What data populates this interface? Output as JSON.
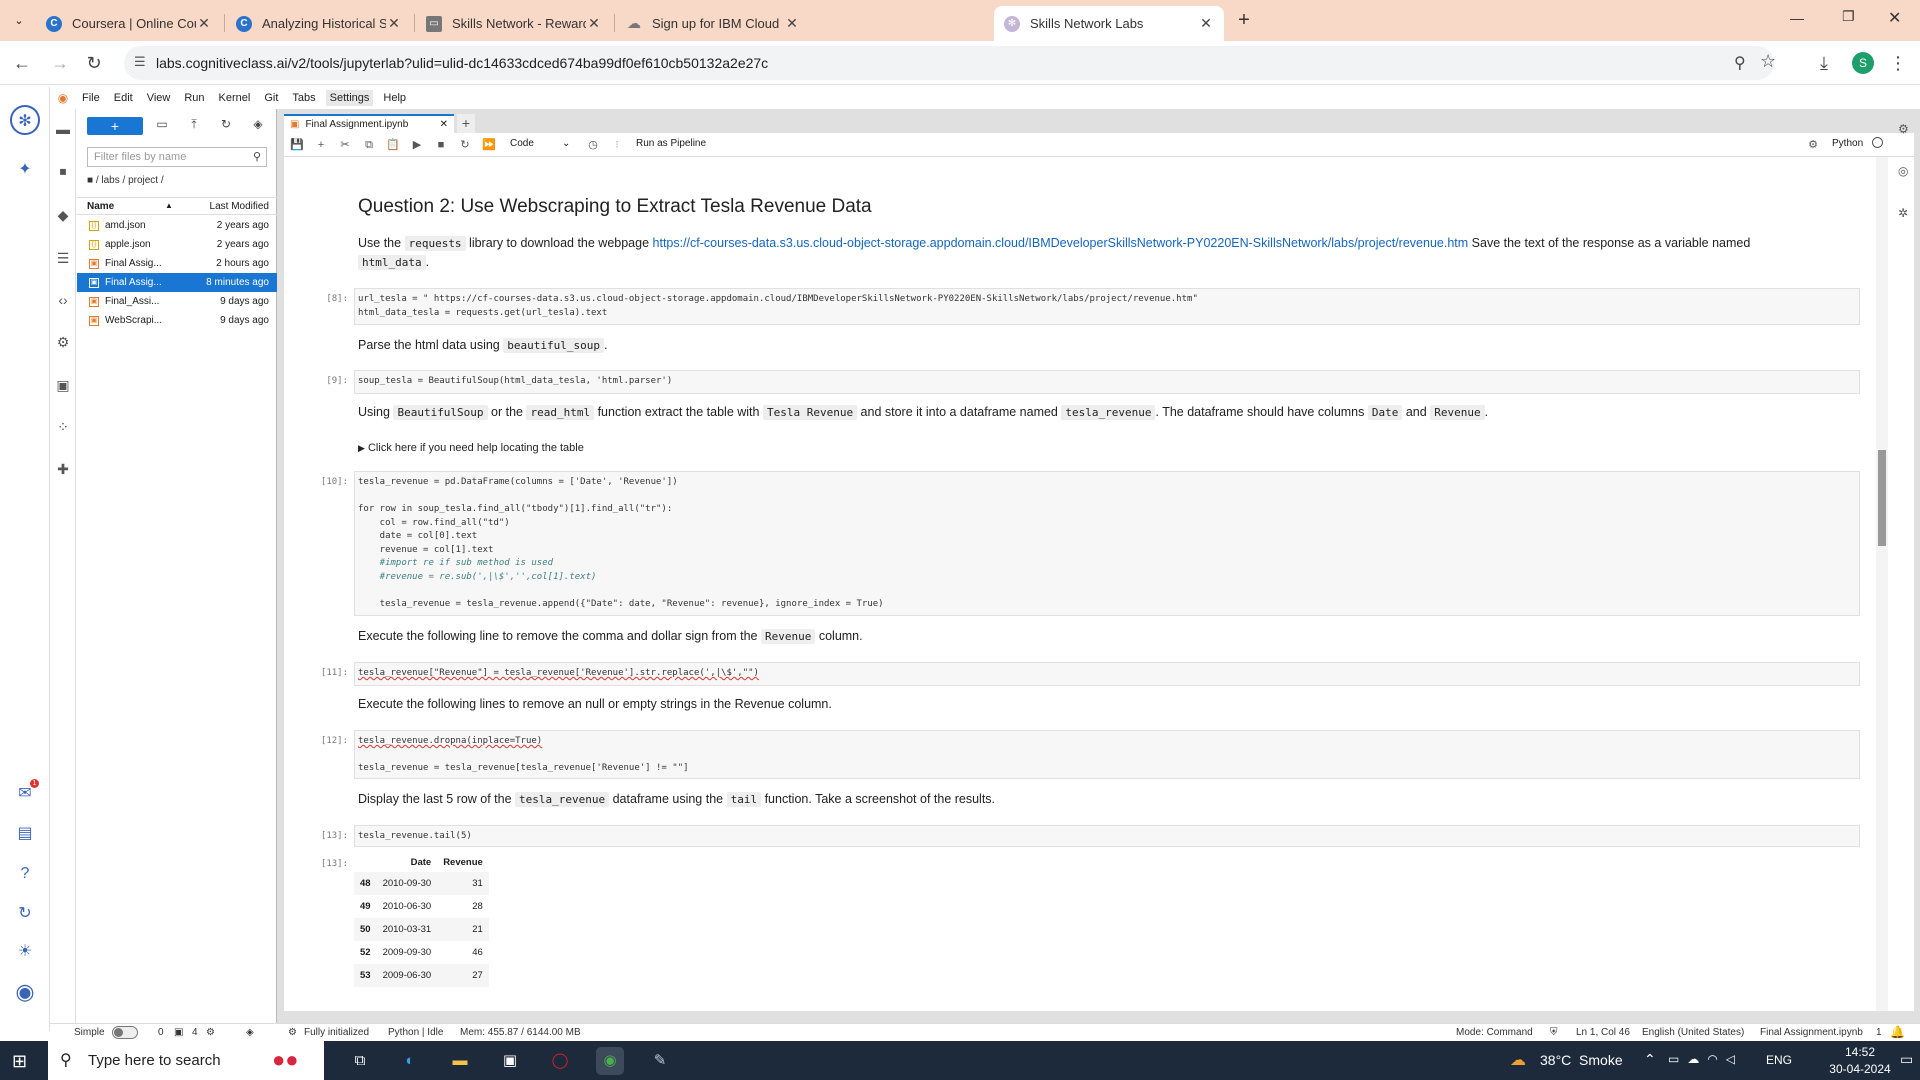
{
  "browser": {
    "tabs": [
      {
        "title": "Coursera | Online Courses Fro",
        "icon": "coursera-icon"
      },
      {
        "title": "Analyzing Historical Stock/Rev",
        "icon": "coursera-icon"
      },
      {
        "title": "Skills Network - Reward",
        "icon": "ticket-icon"
      },
      {
        "title": "Sign up for IBM Cloud",
        "icon": "cloud-icon"
      },
      {
        "title": "Skills Network Labs",
        "icon": "skills-network-icon"
      }
    ],
    "url": "labs.cognitiveclass.ai/v2/tools/jupyterlab?ulid=ulid-dc14633cdced674ba99df0ef610cb50132a2e27c",
    "profile_initial": "S"
  },
  "jupyter": {
    "menu": [
      "File",
      "Edit",
      "View",
      "Run",
      "Kernel",
      "Git",
      "Tabs",
      "Settings",
      "Help"
    ],
    "filebrowser": {
      "filter_placeholder": "Filter files by name",
      "breadcrumb": "/ labs / project /",
      "col_name": "Name",
      "col_modified": "Last Modified",
      "files": [
        {
          "name": "amd.json",
          "modified": "2 years ago"
        },
        {
          "name": "apple.json",
          "modified": "2 years ago"
        },
        {
          "name": "Final Assig...",
          "modified": "2 hours ago"
        },
        {
          "name": "Final Assig...",
          "modified": "8 minutes ago"
        },
        {
          "name": "Final_Assi...",
          "modified": "9 days ago"
        },
        {
          "name": "WebScrapi...",
          "modified": "9 days ago"
        }
      ]
    },
    "doc_tab": "Final Assignment.ipynb",
    "toolbar": {
      "cell_type": "Code",
      "pipeline": "Run as Pipeline",
      "kernel": "Python"
    },
    "notebook": {
      "heading": "Question 2: Use Webscraping to Extract Tesla Revenue Data",
      "md1_a": "Use the",
      "md1_code1": "requests",
      "md1_b": "library to download the webpage",
      "md1_link": "https://cf-courses-data.s3.us.cloud-object-storage.appdomain.cloud/IBMDeveloperSkillsNetwork-PY0220EN-SkillsNetwork/labs/project/revenue.htm",
      "md1_c": "Save the text of the response as a variable named",
      "md1_code2": "html_data",
      "p8": "[8]:",
      "c8_l1": "url_tesla = \" https://cf-courses-data.s3.us.cloud-object-storage.appdomain.cloud/IBMDeveloperSkillsNetwork-PY0220EN-SkillsNetwork/labs/project/revenue.htm\"",
      "c8_l2": "html_data_tesla = requests.get(url_tesla).text",
      "md2_a": "Parse the html data using",
      "md2_code": "beautiful_soup",
      "p9": "[9]:",
      "c9": "soup_tesla = BeautifulSoup(html_data_tesla, 'html.parser')",
      "md3_a": "Using",
      "md3_c1": "BeautifulSoup",
      "md3_b": "or the",
      "md3_c2": "read_html",
      "md3_c": "function extract the table with",
      "md3_c3": "Tesla Revenue",
      "md3_d": "and store it into a dataframe named",
      "md3_c4": "tesla_revenue",
      "md3_e": ". The dataframe should have columns",
      "md3_c5": "Date",
      "md3_f": "and",
      "md3_c6": "Revenue",
      "details": "Click here if you need help locating the table",
      "p10": "[10]:",
      "c10": [
        "tesla_revenue = pd.DataFrame(columns = ['Date', 'Revenue'])",
        "",
        "for row in soup_tesla.find_all(\"tbody\")[1].find_all(\"tr\"):",
        "    col = row.find_all(\"td\")",
        "    date = col[0].text",
        "    revenue = col[1].text",
        "    #import re if sub method is used",
        "    #revenue = re.sub(',|\\$','',col[1].text)",
        "",
        "    tesla_revenue = tesla_revenue.append({\"Date\": date, \"Revenue\": revenue}, ignore_index = True)"
      ],
      "md4_a": "Execute the following line to remove the comma and dollar sign from the",
      "md4_code": "Revenue",
      "md4_b": "column.",
      "p11": "[11]:",
      "c11": "tesla_revenue[\"Revenue\"] = tesla_revenue['Revenue'].str.replace(',|\\$',\"\")",
      "md5": "Execute the following lines to remove an null or empty strings in the Revenue column.",
      "p12": "[12]:",
      "c12_l1": "tesla_revenue.dropna(inplace=True)",
      "c12_l2": "tesla_revenue = tesla_revenue[tesla_revenue['Revenue'] != \"\"]",
      "md6_a": "Display the last 5 row of the",
      "md6_c1": "tesla_revenue",
      "md6_b": "dataframe using the",
      "md6_c2": "tail",
      "md6_c": "function. Take a screenshot of the results.",
      "p13": "[13]:",
      "c13": "tesla_revenue.tail(5)",
      "p13o": "[13]:",
      "table": {
        "columns": [
          "Date",
          "Revenue"
        ],
        "rows": [
          [
            "48",
            "2010-09-30",
            "31"
          ],
          [
            "49",
            "2010-06-30",
            "28"
          ],
          [
            "50",
            "2010-03-31",
            "21"
          ],
          [
            "52",
            "2009-09-30",
            "46"
          ],
          [
            "53",
            "2009-06-30",
            "27"
          ]
        ]
      }
    },
    "status": {
      "mode_label": "Simple",
      "n0": "0",
      "n4": "4",
      "init": "Fully initialized",
      "kernel": "Python | Idle",
      "mem": "Mem: 455.87 / 6144.00 MB",
      "mode": "Mode: Command",
      "pos": "Ln 1, Col 46",
      "lang": "English (United States)",
      "file": "Final Assignment.ipynb",
      "count": "1"
    }
  },
  "taskbar": {
    "search_placeholder": "Type here to search",
    "weather": "38°C  Smoke",
    "lang": "ENG",
    "time": "14:52",
    "date": "30-04-2024"
  }
}
